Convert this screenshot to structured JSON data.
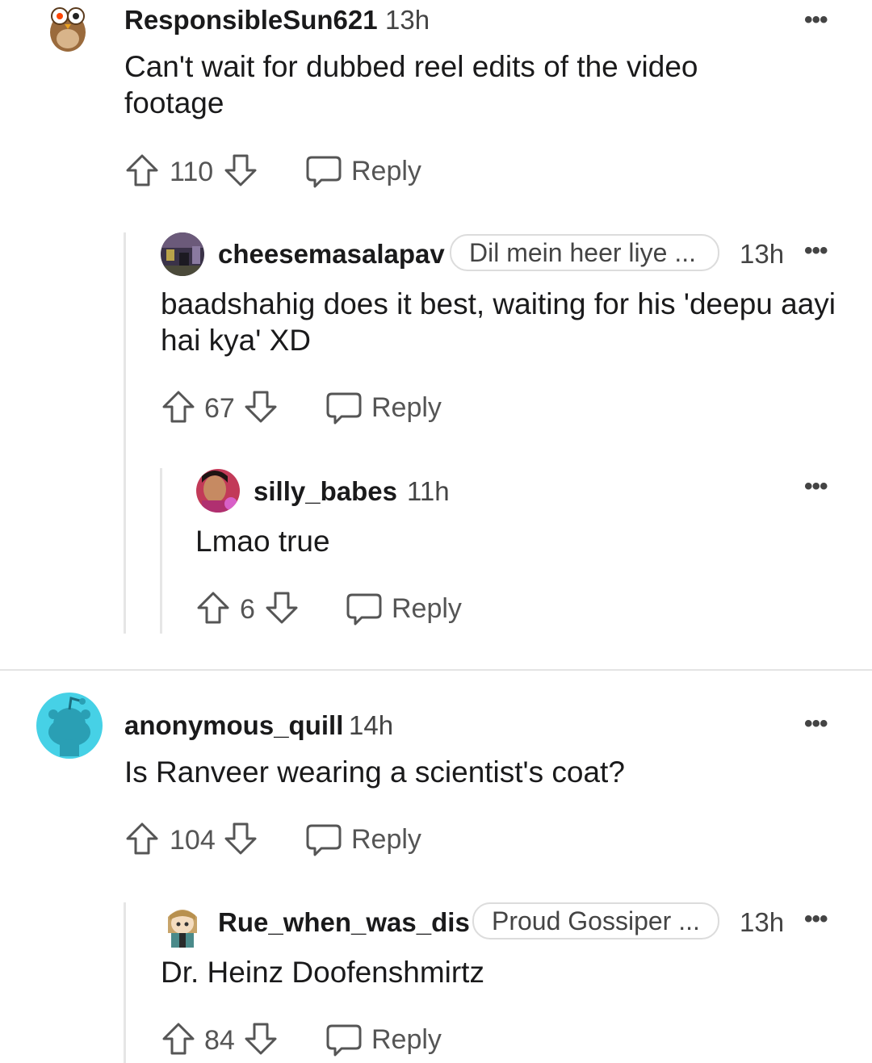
{
  "comments": [
    {
      "username": "ResponsibleSun621",
      "time": "13h",
      "body": "Can't wait for dubbed reel edits of the video footage",
      "votes": "110",
      "reply_label": "Reply",
      "avatar_icon": "owl-snoo-avatar"
    },
    {
      "username": "cheesemasalapav",
      "flair": "Dil mein heer liye ...",
      "time": "13h",
      "body": "baadshahig does it best, waiting for his 'deepu aayi hai kya' XD",
      "votes": "67",
      "reply_label": "Reply",
      "avatar_icon": "photo-avatar"
    },
    {
      "username": "silly_babes",
      "time": "11h",
      "body": "Lmao true",
      "votes": "6",
      "reply_label": "Reply",
      "avatar_icon": "photo-avatar"
    },
    {
      "username": "anonymous_quill",
      "time": "14h",
      "body": "Is Ranveer wearing a scientist's coat?",
      "votes": "104",
      "reply_label": "Reply",
      "avatar_icon": "default-snoo-avatar"
    },
    {
      "username": "Rue_when_was_dis",
      "flair": "Proud Gossiper ...",
      "time": "13h",
      "body": "Dr. Heinz Doofenshmirtz",
      "votes": "84",
      "reply_label": "Reply",
      "avatar_icon": "anime-snoo-avatar"
    }
  ],
  "colors": {
    "accent_avatar": "#46d1e6",
    "text": "#1a1a1b",
    "muted": "#555555"
  }
}
